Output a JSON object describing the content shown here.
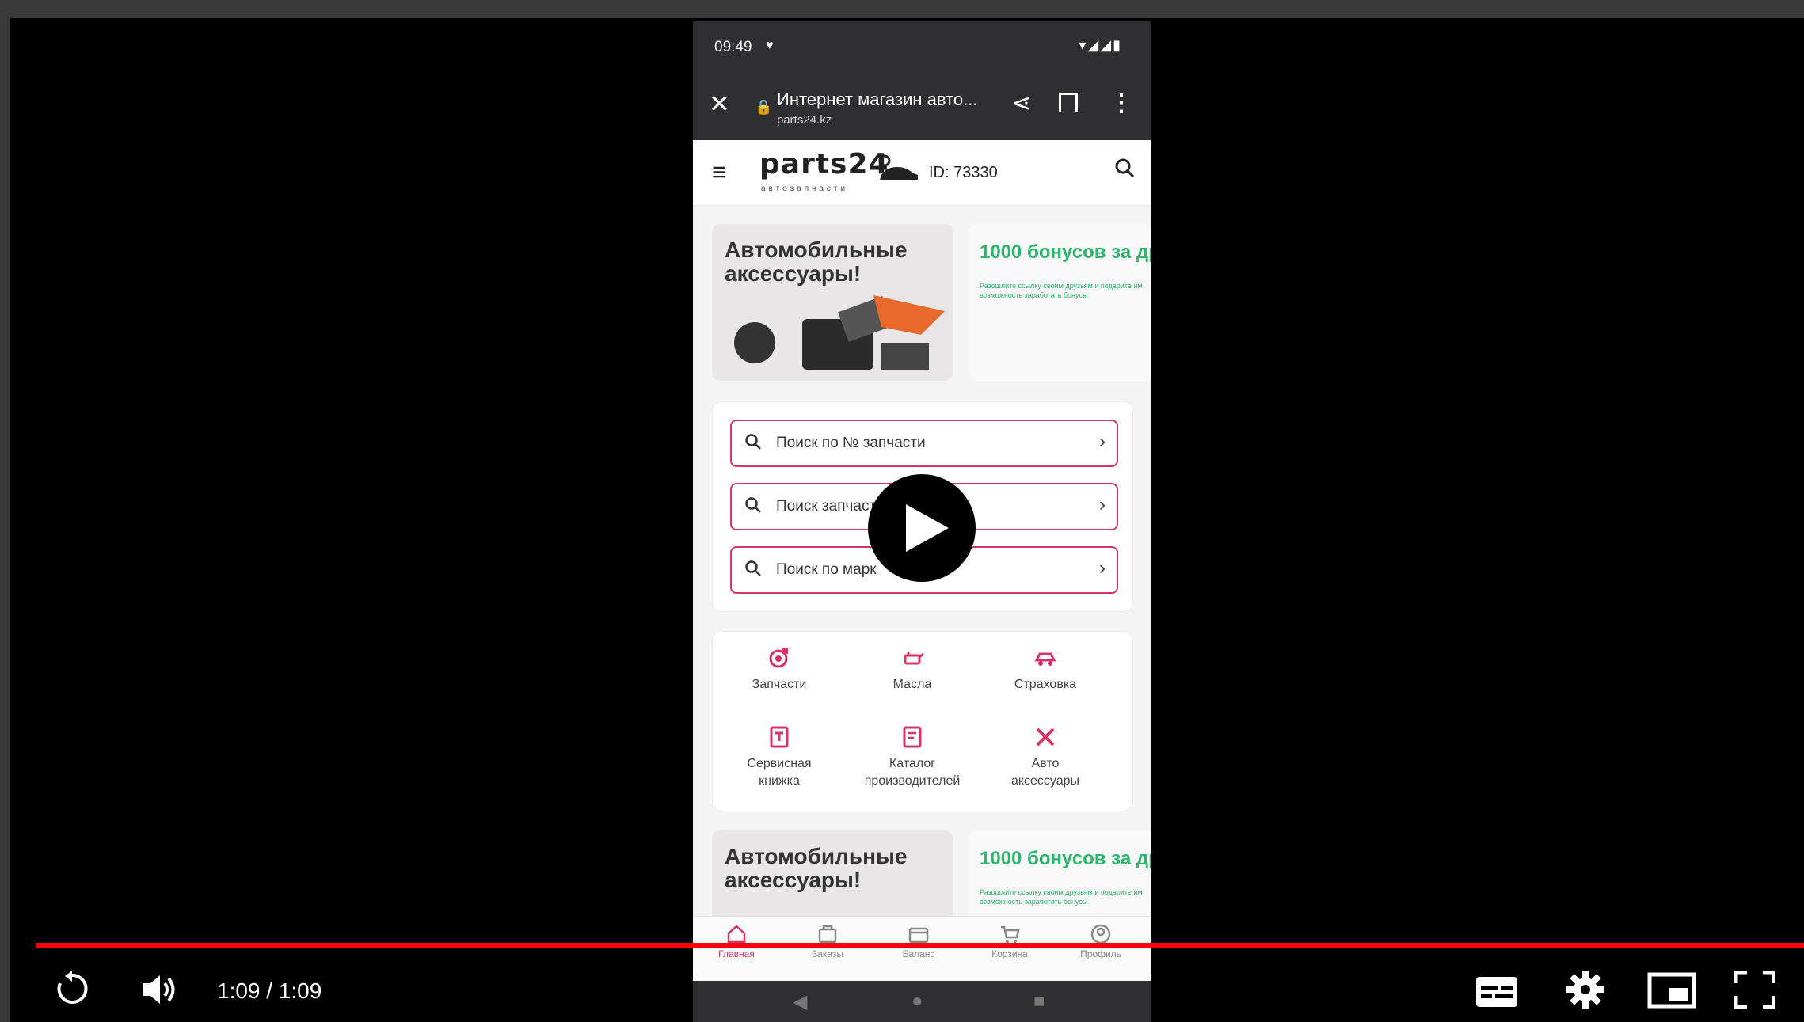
{
  "phone": {
    "status": {
      "time": "09:49"
    },
    "browser": {
      "title": "Интернет магазин авто...",
      "url": "parts24.kz"
    },
    "site": {
      "logo": "parts24",
      "logo_sub": "автозапчасти",
      "id_label": "ID: 73330"
    },
    "banners": {
      "accessories": "Автомобильные аксессуары!",
      "bonus": "1000 бонусов за дру",
      "bonus_sub": "Разошлите ссылку своим друзьям и подарите им возможность заработать бонусы"
    },
    "search": {
      "by_number": "Поиск по № запчасти",
      "by_vin": "Поиск запчаст             АМЕ",
      "by_brand": "Поиск по марк"
    },
    "categories": [
      {
        "label": "Запчасти"
      },
      {
        "label": "Масла"
      },
      {
        "label": "Страховка"
      },
      {
        "label": "Сервисная книжка"
      },
      {
        "label": "Каталог производителей"
      },
      {
        "label": "Авто аксессуары"
      }
    ],
    "tabs": [
      {
        "label": "Главная"
      },
      {
        "label": "Заказы"
      },
      {
        "label": "Баланс"
      },
      {
        "label": "Корзина"
      },
      {
        "label": "Профиль"
      }
    ]
  },
  "player": {
    "time": "1:09 / 1:09",
    "progress": 1.0,
    "accent_color": "#ff0000"
  },
  "colors": {
    "brand": "#d6336c",
    "bonus_green": "#2db56e"
  }
}
